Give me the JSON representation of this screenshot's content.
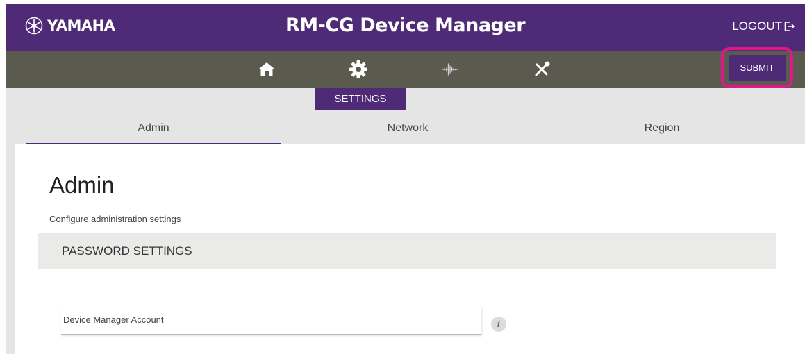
{
  "header": {
    "brand": "YAMAHA",
    "title": "RM-CG Device Manager",
    "logout_label": "LOGOUT"
  },
  "nav": {
    "icons": [
      "home-icon",
      "gear-icon",
      "audio-wave-icon",
      "tools-icon"
    ],
    "active": "gear-icon",
    "submit_label": "SUBMIT",
    "active_section_label": "SETTINGS"
  },
  "tabs": [
    {
      "label": "Admin",
      "active": true
    },
    {
      "label": "Network",
      "active": false
    },
    {
      "label": "Region",
      "active": false
    }
  ],
  "page": {
    "title": "Admin",
    "description": "Configure administration settings"
  },
  "password_section": {
    "header": "PASSWORD SETTINGS",
    "account_field_label": "Device Manager Account",
    "info_icon": "i"
  },
  "colors": {
    "brand_purple": "#4f2a77",
    "nav_bar": "#5b5a4e",
    "highlight": "#e1168b"
  }
}
